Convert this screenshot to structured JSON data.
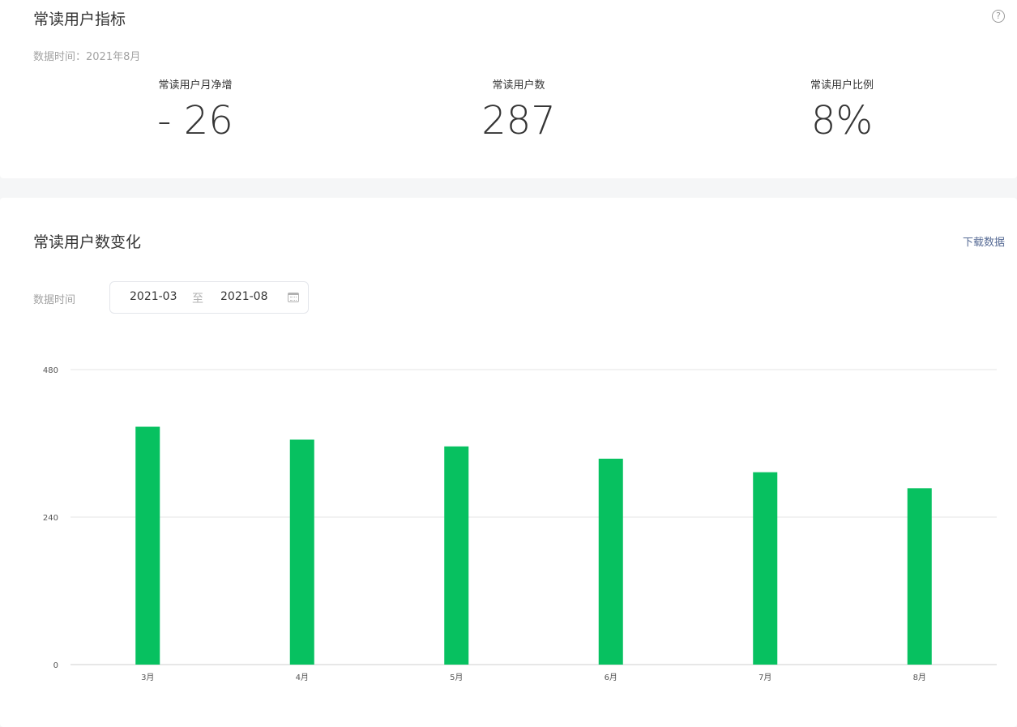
{
  "metrics_card": {
    "title": "常读用户指标",
    "help_icon": "question-circle-icon",
    "data_time": "数据时间：2021年8月",
    "items": [
      {
        "label": "常读用户月净增",
        "value": "- 26"
      },
      {
        "label": "常读用户数",
        "value": "287"
      },
      {
        "label": "常读用户比例",
        "value": "8%"
      }
    ]
  },
  "trend_card": {
    "title": "常读用户数变化",
    "download_label": "下载数据",
    "range_label": "数据时间",
    "date_start": "2021-03",
    "date_separator": "至",
    "date_end": "2021-08",
    "calendar_icon": "calendar-icon"
  },
  "colors": {
    "bar": "#07c160",
    "grid": "#e6e6e6",
    "link": "#576b95"
  },
  "chart_data": {
    "type": "bar",
    "categories": [
      "3月",
      "4月",
      "5月",
      "6月",
      "7月",
      "8月"
    ],
    "values": [
      387,
      366,
      355,
      335,
      313,
      287
    ],
    "yticks": [
      0,
      240,
      480
    ],
    "ylim": [
      0,
      480
    ],
    "grid": true,
    "legend": "none"
  }
}
